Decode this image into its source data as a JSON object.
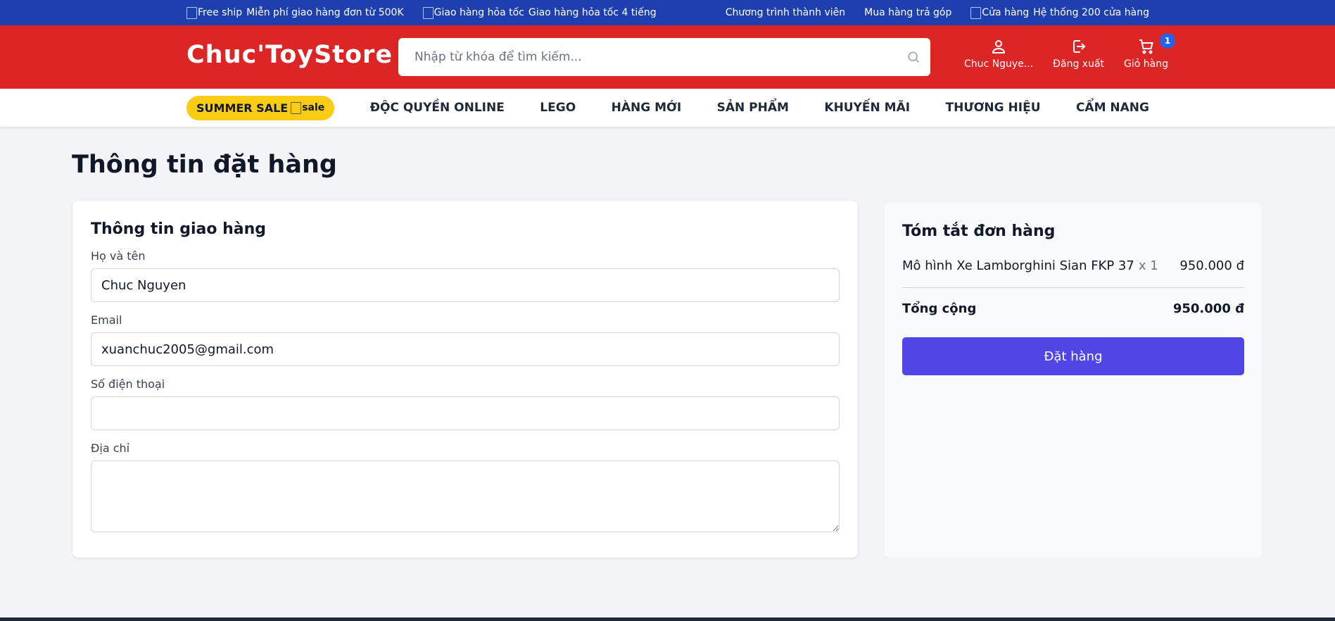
{
  "topbar": {
    "items_left": [
      {
        "img_alt": "Free ship",
        "text": "Miễn phí giao hàng đơn từ 500K"
      },
      {
        "img_alt": "Giao hàng hỏa tốc",
        "text": "Giao hàng hỏa tốc 4 tiếng"
      }
    ],
    "link_member": "Chương trình thành viên",
    "link_installment": "Mua hàng trả góp",
    "store": {
      "img_alt": "Cửa hàng",
      "text": "Hệ thống 200 cửa hàng"
    },
    "color": "#1e40af"
  },
  "header": {
    "logo": "Chuc'ToyStore",
    "search_placeholder": "Nhập từ khóa để tìm kiếm...",
    "search_icon": "search-icon",
    "user_label": "Chuc Nguye...",
    "logout_label": "Đăng xuất",
    "cart_label": "Giỏ hàng",
    "cart_count": "1",
    "color": "#dc2626"
  },
  "nav": {
    "sale_label": "SUMMER SALE",
    "sale_img_alt": "sale",
    "items": [
      "ĐỘC QUYỀN ONLINE",
      "LEGO",
      "HÀNG MỚI",
      "SẢN PHẨM",
      "KHUYẾN MÃI",
      "THƯƠNG HIỆU",
      "CẨM NANG"
    ]
  },
  "page": {
    "title": "Thông tin đặt hàng"
  },
  "shipping": {
    "title": "Thông tin giao hàng",
    "name_label": "Họ và tên",
    "name_value": "Chuc Nguyen",
    "email_label": "Email",
    "email_value": "xuanchuc2005@gmail.com",
    "phone_label": "Số điện thoại",
    "phone_value": "",
    "address_label": "Địa chỉ",
    "address_value": ""
  },
  "summary": {
    "title": "Tóm tắt đơn hàng",
    "item_name": "Mô hình Xe Lamborghini Sian FKP 37",
    "item_qty": "x 1",
    "item_price": "950.000 đ",
    "total_label": "Tổng cộng",
    "total_value": "950.000 đ",
    "order_button": "Đặt hàng",
    "button_color": "#4f46e5"
  }
}
